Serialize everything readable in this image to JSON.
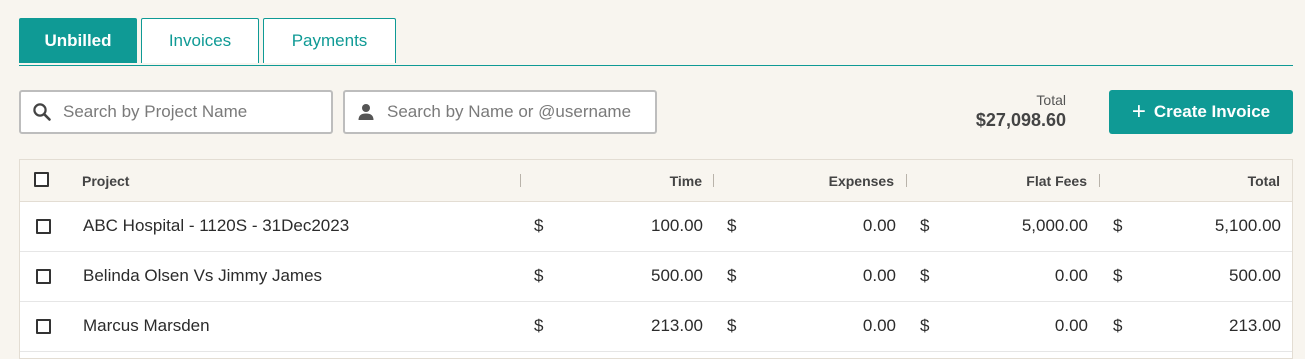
{
  "tabs": [
    {
      "label": "Unbilled",
      "active": true
    },
    {
      "label": "Invoices",
      "active": false
    },
    {
      "label": "Payments",
      "active": false
    }
  ],
  "search": {
    "project_placeholder": "Search by Project Name",
    "name_placeholder": "Search by Name or @username"
  },
  "summary": {
    "total_label": "Total",
    "total_value": "$27,098.60"
  },
  "create_invoice_label": "Create Invoice",
  "table": {
    "headers": {
      "project": "Project",
      "time": "Time",
      "expenses": "Expenses",
      "flat_fees": "Flat Fees",
      "total": "Total"
    },
    "currency_symbol": "$",
    "rows": [
      {
        "project": "ABC Hospital - 1120S - 31Dec2023",
        "time": "100.00",
        "expenses": "0.00",
        "flat_fees": "5,000.00",
        "total": "5,100.00"
      },
      {
        "project": "Belinda Olsen Vs Jimmy James",
        "time": "500.00",
        "expenses": "0.00",
        "flat_fees": "0.00",
        "total": "500.00"
      },
      {
        "project": "Marcus Marsden",
        "time": "213.00",
        "expenses": "0.00",
        "flat_fees": "0.00",
        "total": "213.00"
      }
    ]
  },
  "colors": {
    "accent": "#0f9a95",
    "page_background": "#f8f5ef"
  },
  "icons": {
    "search": "search-icon",
    "user": "user-icon",
    "plus": "plus-icon"
  }
}
